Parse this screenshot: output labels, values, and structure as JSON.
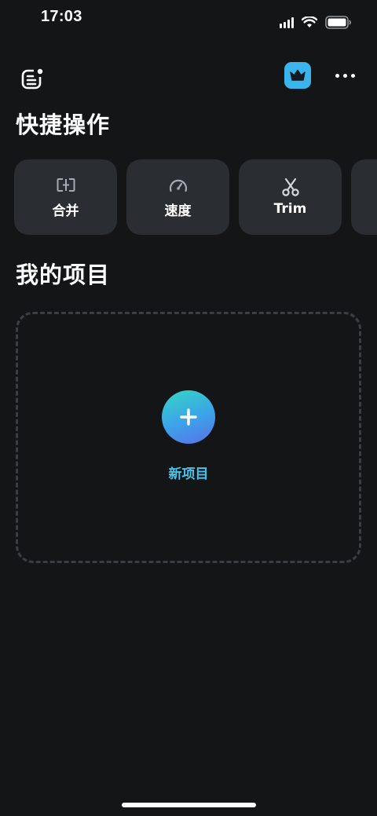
{
  "status_bar": {
    "time": "17:03",
    "icons": [
      "cellular-signal-icon",
      "wifi-icon",
      "battery-icon"
    ]
  },
  "top_bar": {
    "menu_icon": "menu-notification-icon",
    "vip_icon": "crown-icon",
    "more_icon": "more-dots-icon",
    "vip_color": "#3ab4ec"
  },
  "quick_actions": {
    "title": "快捷操作",
    "items": [
      {
        "label": "合并",
        "icon": "merge-icon"
      },
      {
        "label": "速度",
        "icon": "speedometer-icon"
      },
      {
        "label": "Trim",
        "icon": "scissors-icon"
      }
    ]
  },
  "projects": {
    "title": "我的项目",
    "new_project_label": "新项目",
    "new_project_icon": "plus-icon",
    "accent_color": "#49c3ea"
  },
  "colors": {
    "background": "#141517",
    "card": "#2a2d31",
    "dashed_border": "#3b3e43"
  }
}
